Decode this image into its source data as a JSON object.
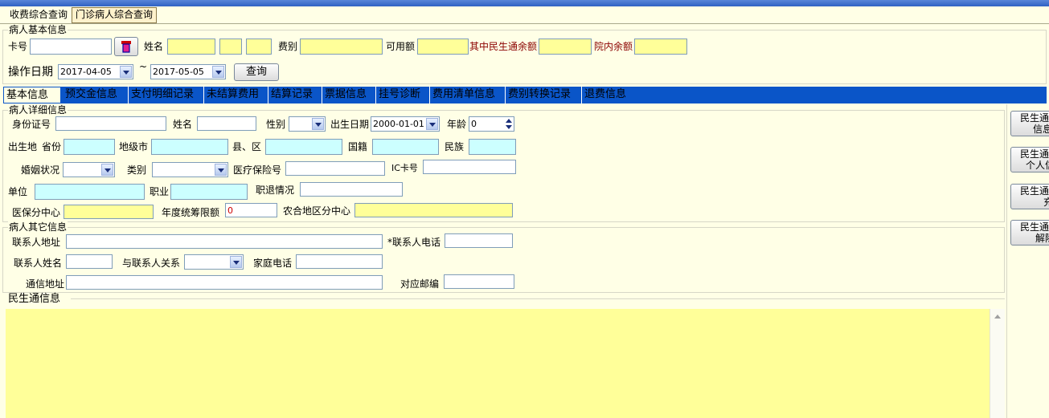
{
  "main_tabs": [
    {
      "label": "收费综合查询",
      "selected": false
    },
    {
      "label": "门诊病人综合查询",
      "selected": true
    }
  ],
  "basic_group": {
    "title": "病人基本信息",
    "card_label": "卡号",
    "card_value": "",
    "name_label": "姓名",
    "fee_type_label": "费别",
    "available_label": "可用额",
    "msn_balance_label": "其中民生通余额",
    "hospital_balance_label": "院内余额",
    "op_date_label": "操作日期",
    "date_from": "2017-04-05",
    "date_sep": "~",
    "date_to": "2017-05-05",
    "query_button": "查询"
  },
  "inner_tabs": [
    {
      "label": "基本信息",
      "selected": true
    },
    {
      "label": "预交金信息"
    },
    {
      "label": "支付明细记录"
    },
    {
      "label": "未结算费用"
    },
    {
      "label": "结算记录"
    },
    {
      "label": "票据信息"
    },
    {
      "label": "挂号诊断"
    },
    {
      "label": "费用清单信息"
    },
    {
      "label": "费别转换记录"
    },
    {
      "label": "退费信息"
    }
  ],
  "detail_group": {
    "title": "病人详细信息",
    "id_label": "身份证号",
    "name_label": "姓名",
    "gender_label": "性别",
    "birth_label": "出生日期",
    "birth_value": "2000-01-01",
    "age_label": "年龄",
    "age_value": "0",
    "birthplace_label": "出生地",
    "province_label": "省份",
    "city_label": "地级市",
    "county_label": "县、区",
    "nationality_label": "国籍",
    "ethnicity_label": "民族",
    "marital_label": "婚姻状况",
    "category_label": "类别",
    "insurance_no_label": "医疗保险号",
    "ic_label": "IC卡号",
    "unit_label": "单位",
    "job_label": "职业",
    "retire_label": "职退情况",
    "insure_center_label": "医保分中心",
    "annual_limit_label": "年度统筹限额",
    "annual_limit_value": "0",
    "rural_center_label": "农合地区分中心"
  },
  "other_group": {
    "title": "病人其它信息",
    "contact_addr_label": "联系人地址",
    "contact_phone_label": "*联系人电话",
    "contact_name_label": "联系人姓名",
    "relation_label": "与联系人关系",
    "home_phone_label": "家庭电话",
    "mail_addr_label": "通信地址",
    "zip_label": "对应邮编"
  },
  "msn_group": {
    "title": "民生通信息"
  },
  "side_buttons": [
    {
      "line1": "民生通",
      "line2": "信息"
    },
    {
      "line1": "民生通",
      "line2": "个人信"
    },
    {
      "line1": "民生通",
      "line2": "充"
    },
    {
      "line1": "民生通",
      "line2": "解除"
    }
  ],
  "colors": {
    "yellow_field": "#ffff99",
    "cyan_field": "#ccffff",
    "tab_blue": "#0a55c8",
    "maroon_text": "#8b0000"
  }
}
